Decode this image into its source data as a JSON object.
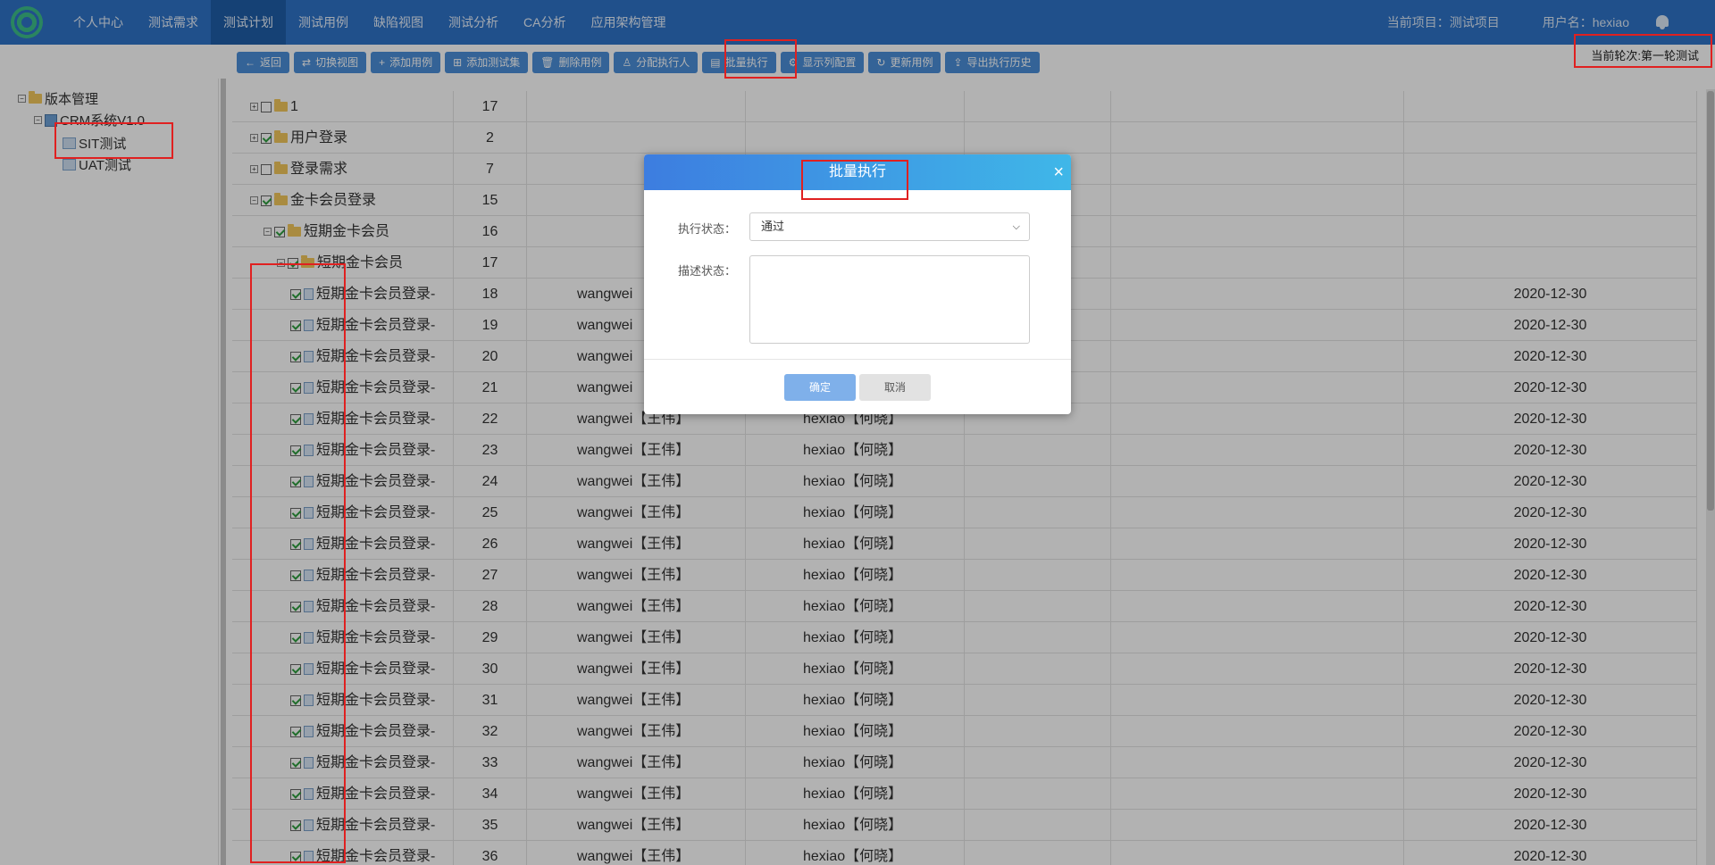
{
  "topbar": {
    "nav": [
      {
        "label": "个人中心",
        "active": false
      },
      {
        "label": "测试需求",
        "active": false
      },
      {
        "label": "测试计划",
        "active": true
      },
      {
        "label": "测试用例",
        "active": false
      },
      {
        "label": "缺陷视图",
        "active": false
      },
      {
        "label": "测试分析",
        "active": false
      },
      {
        "label": "CA分析",
        "active": false
      },
      {
        "label": "应用架构管理",
        "active": false
      }
    ],
    "project": "当前项目：测试项目",
    "user": "用户名：hexiao"
  },
  "toolbar": {
    "buttons": [
      {
        "icon": "←",
        "label": "返回"
      },
      {
        "icon": "⇄",
        "label": "切换视图"
      },
      {
        "icon": "+",
        "label": "添加用例"
      },
      {
        "icon": "⊞",
        "label": "添加测试集"
      },
      {
        "icon": "🗑",
        "label": "删除用例"
      },
      {
        "icon": "♙",
        "label": "分配执行人"
      },
      {
        "icon": "▤",
        "label": "批量执行"
      },
      {
        "icon": "⚙",
        "label": "显示列配置"
      },
      {
        "icon": "↻",
        "label": "更新用例"
      },
      {
        "icon": "⇪",
        "label": "导出执行历史"
      }
    ],
    "round": "当前轮次:第一轮测试"
  },
  "tree": {
    "root": "版本管理",
    "version": "CRM系统V1.0",
    "children": [
      "SIT测试",
      "UAT测试"
    ]
  },
  "grid": {
    "rows": [
      {
        "name": "1",
        "id": "17",
        "level": 0,
        "type": "folder",
        "checked": false,
        "expander": "+",
        "executor": "",
        "assignee": "",
        "date": ""
      },
      {
        "name": "用户登录",
        "id": "2",
        "level": 0,
        "type": "folder",
        "checked": true,
        "expander": "+",
        "executor": "",
        "assignee": "",
        "date": ""
      },
      {
        "name": "登录需求",
        "id": "7",
        "level": 0,
        "type": "folder",
        "checked": false,
        "expander": "+",
        "executor": "",
        "assignee": "",
        "date": ""
      },
      {
        "name": "金卡会员登录",
        "id": "15",
        "level": 0,
        "type": "folder",
        "checked": true,
        "expander": "−",
        "executor": "",
        "assignee": "",
        "date": ""
      },
      {
        "name": "短期金卡会员",
        "id": "16",
        "level": 1,
        "type": "folder",
        "checked": true,
        "expander": "−",
        "executor": "",
        "assignee": "",
        "date": ""
      },
      {
        "name": "短期金卡会员",
        "id": "17",
        "level": 2,
        "type": "folder",
        "checked": true,
        "expander": "−",
        "executor": "",
        "assignee": "",
        "date": ""
      },
      {
        "name": "短期金卡会员登录-",
        "id": "18",
        "level": 3,
        "type": "case",
        "checked": true,
        "expander": "",
        "executor": "wangwei",
        "assignee": "",
        "date": "2020-12-30"
      },
      {
        "name": "短期金卡会员登录-",
        "id": "19",
        "level": 3,
        "type": "case",
        "checked": true,
        "expander": "",
        "executor": "wangwei",
        "assignee": "",
        "date": "2020-12-30"
      },
      {
        "name": "短期金卡会员登录-",
        "id": "20",
        "level": 3,
        "type": "case",
        "checked": true,
        "expander": "",
        "executor": "wangwei",
        "assignee": "",
        "date": "2020-12-30"
      },
      {
        "name": "短期金卡会员登录-",
        "id": "21",
        "level": 3,
        "type": "case",
        "checked": true,
        "expander": "",
        "executor": "wangwei",
        "assignee": "",
        "date": "2020-12-30"
      },
      {
        "name": "短期金卡会员登录-",
        "id": "22",
        "level": 3,
        "type": "case",
        "checked": true,
        "expander": "",
        "executor": "wangwei【王伟】",
        "assignee": "hexiao【何晓】",
        "date": "2020-12-30"
      },
      {
        "name": "短期金卡会员登录-",
        "id": "23",
        "level": 3,
        "type": "case",
        "checked": true,
        "expander": "",
        "executor": "wangwei【王伟】",
        "assignee": "hexiao【何晓】",
        "date": "2020-12-30"
      },
      {
        "name": "短期金卡会员登录-",
        "id": "24",
        "level": 3,
        "type": "case",
        "checked": true,
        "expander": "",
        "executor": "wangwei【王伟】",
        "assignee": "hexiao【何晓】",
        "date": "2020-12-30"
      },
      {
        "name": "短期金卡会员登录-",
        "id": "25",
        "level": 3,
        "type": "case",
        "checked": true,
        "expander": "",
        "executor": "wangwei【王伟】",
        "assignee": "hexiao【何晓】",
        "date": "2020-12-30"
      },
      {
        "name": "短期金卡会员登录-",
        "id": "26",
        "level": 3,
        "type": "case",
        "checked": true,
        "expander": "",
        "executor": "wangwei【王伟】",
        "assignee": "hexiao【何晓】",
        "date": "2020-12-30"
      },
      {
        "name": "短期金卡会员登录-",
        "id": "27",
        "level": 3,
        "type": "case",
        "checked": true,
        "expander": "",
        "executor": "wangwei【王伟】",
        "assignee": "hexiao【何晓】",
        "date": "2020-12-30"
      },
      {
        "name": "短期金卡会员登录-",
        "id": "28",
        "level": 3,
        "type": "case",
        "checked": true,
        "expander": "",
        "executor": "wangwei【王伟】",
        "assignee": "hexiao【何晓】",
        "date": "2020-12-30"
      },
      {
        "name": "短期金卡会员登录-",
        "id": "29",
        "level": 3,
        "type": "case",
        "checked": true,
        "expander": "",
        "executor": "wangwei【王伟】",
        "assignee": "hexiao【何晓】",
        "date": "2020-12-30"
      },
      {
        "name": "短期金卡会员登录-",
        "id": "30",
        "level": 3,
        "type": "case",
        "checked": true,
        "expander": "",
        "executor": "wangwei【王伟】",
        "assignee": "hexiao【何晓】",
        "date": "2020-12-30"
      },
      {
        "name": "短期金卡会员登录-",
        "id": "31",
        "level": 3,
        "type": "case",
        "checked": true,
        "expander": "",
        "executor": "wangwei【王伟】",
        "assignee": "hexiao【何晓】",
        "date": "2020-12-30"
      },
      {
        "name": "短期金卡会员登录-",
        "id": "32",
        "level": 3,
        "type": "case",
        "checked": true,
        "expander": "",
        "executor": "wangwei【王伟】",
        "assignee": "hexiao【何晓】",
        "date": "2020-12-30"
      },
      {
        "name": "短期金卡会员登录-",
        "id": "33",
        "level": 3,
        "type": "case",
        "checked": true,
        "expander": "",
        "executor": "wangwei【王伟】",
        "assignee": "hexiao【何晓】",
        "date": "2020-12-30"
      },
      {
        "name": "短期金卡会员登录-",
        "id": "34",
        "level": 3,
        "type": "case",
        "checked": true,
        "expander": "",
        "executor": "wangwei【王伟】",
        "assignee": "hexiao【何晓】",
        "date": "2020-12-30"
      },
      {
        "name": "短期金卡会员登录-",
        "id": "35",
        "level": 3,
        "type": "case",
        "checked": true,
        "expander": "",
        "executor": "wangwei【王伟】",
        "assignee": "hexiao【何晓】",
        "date": "2020-12-30"
      },
      {
        "name": "短期金卡会员登录-",
        "id": "36",
        "level": 3,
        "type": "case",
        "checked": true,
        "expander": "",
        "executor": "wangwei【王伟】",
        "assignee": "hexiao【何晓】",
        "date": "2020-12-30"
      }
    ]
  },
  "dialog": {
    "title": "批量执行",
    "status_label": "执行状态：",
    "status_value": "通过",
    "desc_label": "描述状态：",
    "desc_value": "",
    "ok_label": "确定",
    "cancel_label": "取消"
  },
  "colors": {
    "topbar": "#2f73c8",
    "active_nav": "#1f5ea8",
    "toolbar_button": "#4b8fd9",
    "highlight": "#e02020"
  }
}
